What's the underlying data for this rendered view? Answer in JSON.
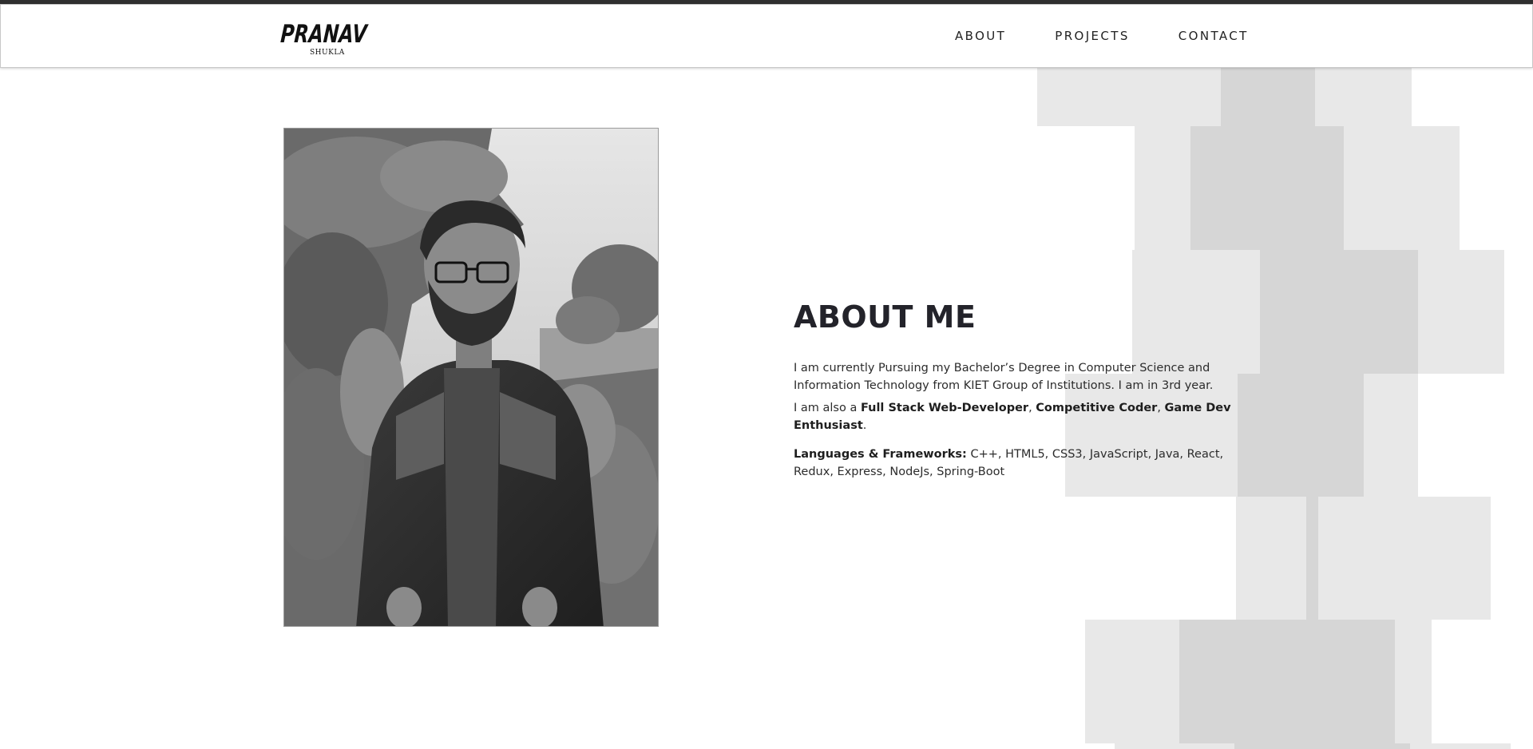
{
  "logo": {
    "name": "PRANAV",
    "surname": "SHUKLA"
  },
  "nav": {
    "items": [
      {
        "label": "ABOUT"
      },
      {
        "label": "PROJECTS"
      },
      {
        "label": "CONTACT"
      }
    ]
  },
  "photo": {
    "alt": "Portrait photo"
  },
  "about": {
    "title": "ABOUT ME",
    "paragraph1": "I am currently Pursuing my Bachelor’s Degree in Computer Science and Information Technology from KIET Group of Institutions. I am in 3rd year.",
    "paragraph2": {
      "prefix": "I am also a ",
      "skill1": "Full Stack Web-Developer",
      "sep1": ", ",
      "skill2": "Competitive Coder",
      "sep2": ", ",
      "skill3": "Game Dev Enthusiast",
      "suffix": "."
    },
    "languages": {
      "label": "Languages & Frameworks:",
      "value": " C++, HTML5, CSS3, JavaScript, Java, React, Redux, Express, NodeJs, Spring-Boot"
    }
  },
  "colors": {
    "block_light": "#e8e8e8",
    "block_dark": "#d6d6d6",
    "text": "#222222",
    "topbar": "#2f2f2f"
  }
}
